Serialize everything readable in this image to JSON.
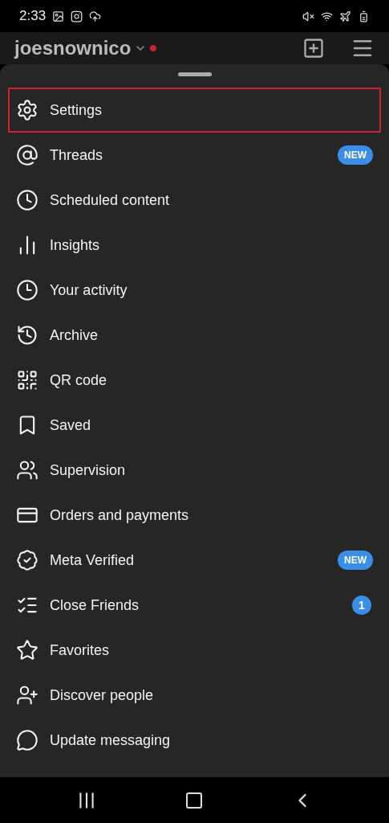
{
  "status_bar": {
    "time": "2:33"
  },
  "header": {
    "username": "joesnownico",
    "notification_dot": true
  },
  "menu": [
    {
      "label": "Settings",
      "highlighted": true
    },
    {
      "label": "Threads",
      "highlighted": false,
      "badge": {
        "kind": "pill",
        "text": "NEW"
      }
    },
    {
      "label": "Scheduled content",
      "highlighted": false
    },
    {
      "label": "Insights",
      "highlighted": false
    },
    {
      "label": "Your activity",
      "highlighted": false
    },
    {
      "label": "Archive",
      "highlighted": false
    },
    {
      "label": "QR code",
      "highlighted": false
    },
    {
      "label": "Saved",
      "highlighted": false
    },
    {
      "label": "Supervision",
      "highlighted": false
    },
    {
      "label": "Orders and payments",
      "highlighted": false
    },
    {
      "label": "Meta Verified",
      "highlighted": false,
      "badge": {
        "kind": "pill",
        "text": "NEW"
      }
    },
    {
      "label": "Close Friends",
      "highlighted": false,
      "badge": {
        "kind": "count",
        "text": "1"
      }
    },
    {
      "label": "Favorites",
      "highlighted": false
    },
    {
      "label": "Discover people",
      "highlighted": false
    },
    {
      "label": "Update messaging",
      "highlighted": false
    }
  ]
}
